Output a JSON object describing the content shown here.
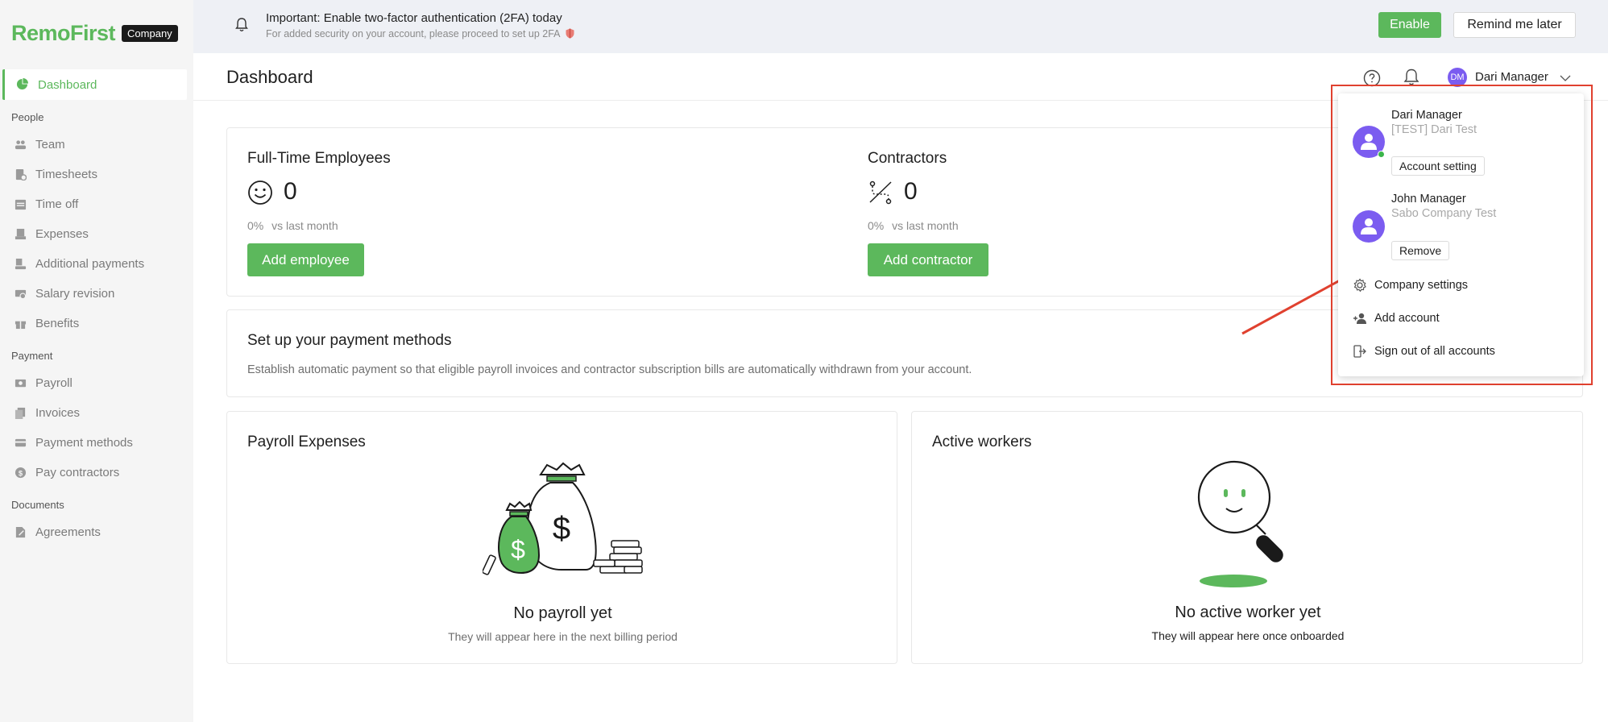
{
  "logo": {
    "text": "RemoFirst",
    "badge": "Company"
  },
  "sidebar": {
    "items": [
      {
        "label": "Dashboard",
        "icon": "pie-chart-icon",
        "active": true
      },
      {
        "section": "People"
      },
      {
        "label": "Team",
        "icon": "team-icon"
      },
      {
        "label": "Timesheets",
        "icon": "timesheet-icon"
      },
      {
        "label": "Time off",
        "icon": "calendar-icon"
      },
      {
        "label": "Expenses",
        "icon": "receipt-icon"
      },
      {
        "label": "Additional payments",
        "icon": "payment-icon"
      },
      {
        "label": "Salary revision",
        "icon": "salary-icon"
      },
      {
        "label": "Benefits",
        "icon": "gift-icon"
      },
      {
        "section": "Payment"
      },
      {
        "label": "Payroll",
        "icon": "money-icon"
      },
      {
        "label": "Invoices",
        "icon": "invoice-icon"
      },
      {
        "label": "Payment methods",
        "icon": "card-icon"
      },
      {
        "label": "Pay contractors",
        "icon": "dollar-circle-icon"
      },
      {
        "section": "Documents"
      },
      {
        "label": "Agreements",
        "icon": "document-icon"
      }
    ]
  },
  "banner": {
    "title": "Important: Enable two-factor authentication (2FA) today",
    "subtitle": "For added security on your account, please proceed to set up 2FA",
    "enable_label": "Enable",
    "remind_label": "Remind me later"
  },
  "header": {
    "title": "Dashboard",
    "avatar_initials": "DM",
    "user_name": "Dari Manager"
  },
  "stats": {
    "employees": {
      "title": "Full-Time Employees",
      "value": "0",
      "change": "0%",
      "change_label": "vs last month",
      "button": "Add employee"
    },
    "contractors": {
      "title": "Contractors",
      "value": "0",
      "change": "0%",
      "change_label": "vs last month",
      "button": "Add contractor"
    }
  },
  "payment_setup": {
    "title": "Set up your payment methods",
    "description": "Establish automatic payment so that eligible payroll invoices and contractor subscription bills are automatically withdrawn from your account."
  },
  "payroll_card": {
    "title": "Payroll Expenses",
    "empty_title": "No payroll yet",
    "empty_subtitle": "They will appear here in the next billing period"
  },
  "workers_card": {
    "title": "Active workers",
    "empty_title": "No active worker yet",
    "empty_subtitle": "They will appear here once onboarded"
  },
  "dropdown": {
    "accounts": [
      {
        "name": "Dari Manager",
        "company": "[TEST] Dari Test",
        "action": "Account setting",
        "online": true
      },
      {
        "name": "John Manager",
        "company": "Sabo Company Test",
        "action": "Remove",
        "online": false
      }
    ],
    "menu": [
      {
        "label": "Company settings",
        "icon": "gear-icon"
      },
      {
        "label": "Add account",
        "icon": "add-user-icon"
      },
      {
        "label": "Sign out of all accounts",
        "icon": "sign-out-icon"
      }
    ]
  },
  "colors": {
    "brand_green": "#5cb85c",
    "avatar_purple": "#7b5cf0",
    "highlight_red": "#e0412f",
    "online_green": "#3bb54a"
  }
}
